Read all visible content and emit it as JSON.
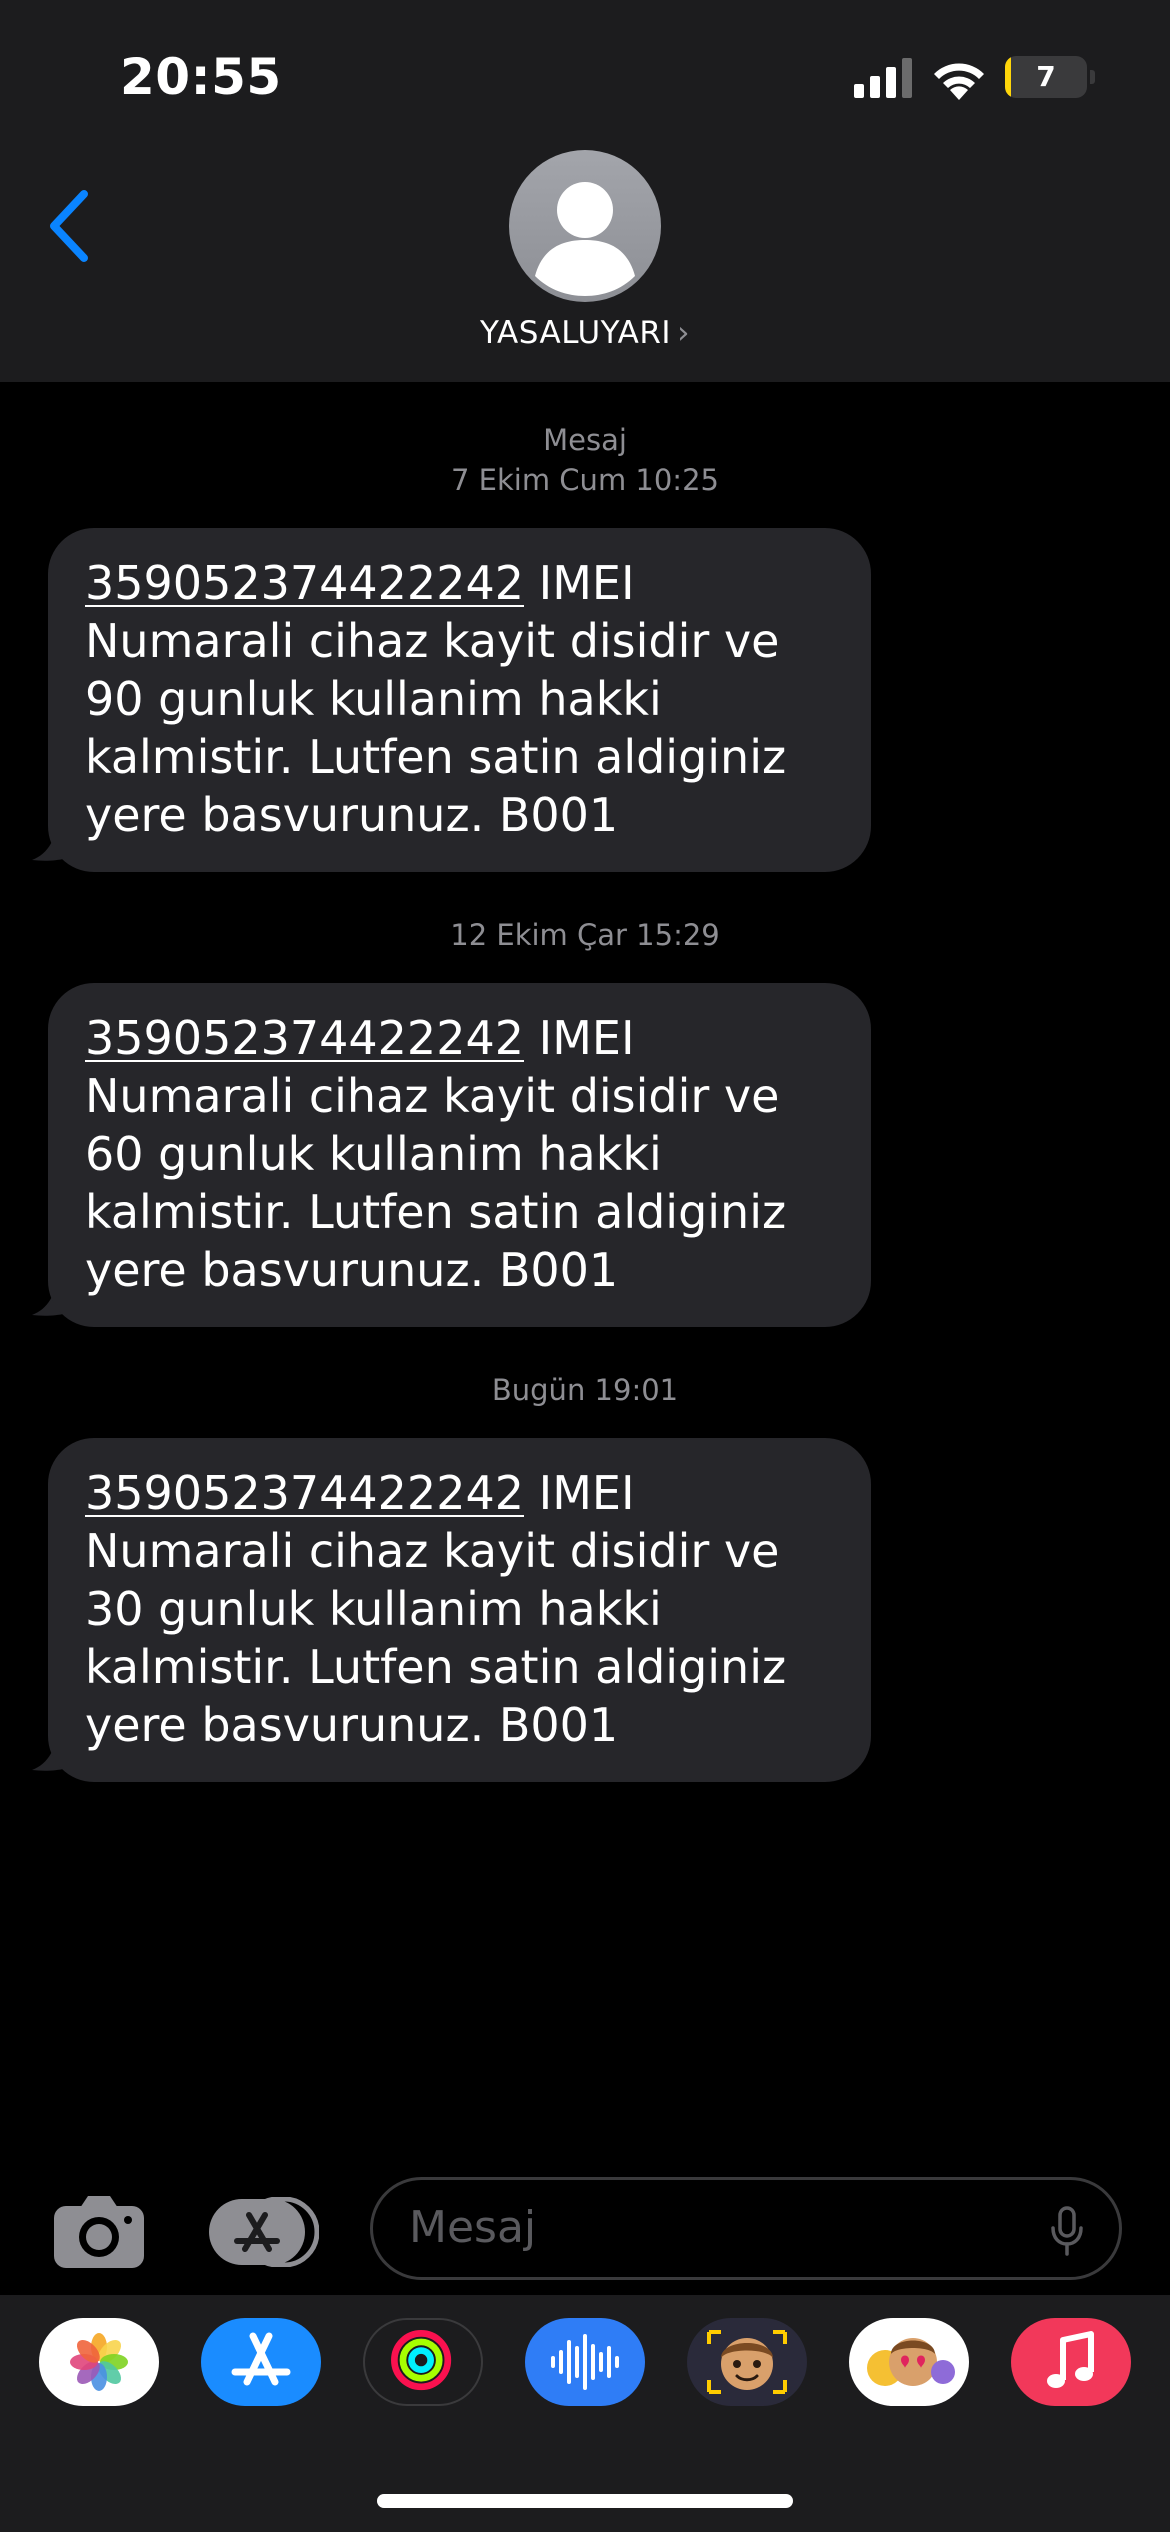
{
  "status_bar": {
    "time": "20:55",
    "battery_level": "7",
    "battery_fraction": 0.07
  },
  "header": {
    "contact_name": "YASALUYARI",
    "chevron": "›",
    "back_icon": "chevron-left-icon"
  },
  "messages": [
    {
      "stamp_line1": "Mesaj",
      "stamp_line2": "7 Ekim Cum 10:25",
      "imei": "359052374422242",
      "body": " IMEI Numarali cihaz kayit disidir ve 90 gunluk kullanim hakki kalmistir. Lutfen satin aldiginiz yere basvurunuz. B001"
    },
    {
      "stamp_line2": "12 Ekim Çar 15:29",
      "imei": "359052374422242",
      "body": " IMEI Numarali cihaz kayit disidir ve 60 gunluk kullanim hakki kalmistir. Lutfen satin aldiginiz yere basvurunuz. B001"
    },
    {
      "stamp_line2": "Bugün 19:01",
      "imei": "359052374422242",
      "body": " IMEI Numarali cihaz kayit disidir ve 30 gunluk kullanim hakki kalmistir. Lutfen satin aldiginiz yere basvurunuz. B001"
    }
  ],
  "input": {
    "placeholder": "Mesaj"
  },
  "app_drawer": [
    "photos-app-icon",
    "app-store-app-icon",
    "activity-app-icon",
    "audio-message-app-icon",
    "memoji-camera-app-icon",
    "memoji-stickers-app-icon",
    "music-app-icon"
  ],
  "colors": {
    "accent": "#0a84ff",
    "bubble": "#26262a",
    "header": "#1c1c1e",
    "timestamp": "#8e8e93",
    "battery_low": "#ffd60a"
  }
}
